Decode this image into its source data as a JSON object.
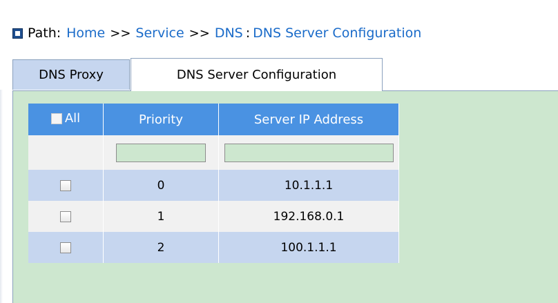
{
  "path": {
    "label": "Path:",
    "home": "Home",
    "sep1": ">>",
    "service": "Service",
    "sep2": ">>",
    "dns": "DNS",
    "colon": ":",
    "current": "DNS Server Configuration"
  },
  "tabs": [
    {
      "label": "DNS Proxy",
      "active": false
    },
    {
      "label": "DNS Server Configuration",
      "active": true
    }
  ],
  "table": {
    "headers": {
      "all": "All",
      "priority": "Priority",
      "server_ip": "Server IP Address"
    },
    "new_entry": {
      "priority": "",
      "server_ip": ""
    },
    "rows": [
      {
        "checked": false,
        "priority": "0",
        "server_ip": "10.1.1.1"
      },
      {
        "checked": false,
        "priority": "1",
        "server_ip": "192.168.0.1"
      },
      {
        "checked": false,
        "priority": "2",
        "server_ip": "100.1.1.1"
      }
    ]
  },
  "colors": {
    "link": "#1a6bc9",
    "table_header": "#4a92e2",
    "content_bg": "#cde7cf",
    "row_highlight": "#c6d6ef",
    "row_plain": "#f1f1f1"
  },
  "icons": {
    "path_marker": "square-bullet-icon"
  }
}
